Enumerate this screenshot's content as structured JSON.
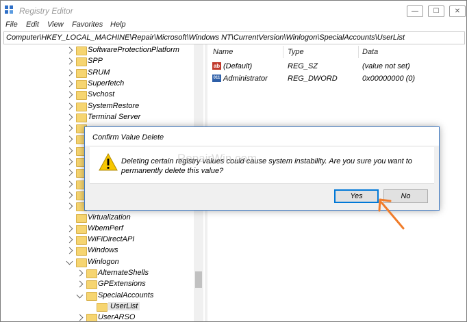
{
  "window": {
    "title": "Registry Editor"
  },
  "controls": {
    "minimize": "—",
    "maximize": "☐",
    "close": "✕"
  },
  "menu": [
    "File",
    "Edit",
    "View",
    "Favorites",
    "Help"
  ],
  "address": "Computer\\HKEY_LOCAL_MACHINE\\Repair\\Microsoft\\Windows NT\\CurrentVersion\\Winlogon\\SpecialAccounts\\UserList",
  "tree": [
    {
      "label": "SoftwareProtectionPlatform",
      "depth": 1,
      "state": "collapsed"
    },
    {
      "label": "SPP",
      "depth": 1,
      "state": "collapsed"
    },
    {
      "label": "SRUM",
      "depth": 1,
      "state": "collapsed"
    },
    {
      "label": "Superfetch",
      "depth": 1,
      "state": "collapsed"
    },
    {
      "label": "Svchost",
      "depth": 1,
      "state": "collapsed"
    },
    {
      "label": "SystemRestore",
      "depth": 1,
      "state": "collapsed"
    },
    {
      "label": "Terminal Server",
      "depth": 1,
      "state": "collapsed"
    },
    {
      "label": "",
      "depth": 1,
      "state": "collapsed"
    },
    {
      "label": "",
      "depth": 1,
      "state": "collapsed"
    },
    {
      "label": "",
      "depth": 1,
      "state": "collapsed"
    },
    {
      "label": "",
      "depth": 1,
      "state": "collapsed"
    },
    {
      "label": "",
      "depth": 1,
      "state": "collapsed"
    },
    {
      "label": "",
      "depth": 1,
      "state": "collapsed"
    },
    {
      "label": "",
      "depth": 1,
      "state": "collapsed"
    },
    {
      "label": "",
      "depth": 1,
      "state": "collapsed"
    },
    {
      "label": "Virtualization",
      "depth": 1,
      "state": "none"
    },
    {
      "label": "WbemPerf",
      "depth": 1,
      "state": "collapsed"
    },
    {
      "label": "WiFiDirectAPI",
      "depth": 1,
      "state": "collapsed"
    },
    {
      "label": "Windows",
      "depth": 1,
      "state": "collapsed"
    },
    {
      "label": "Winlogon",
      "depth": 1,
      "state": "expanded"
    },
    {
      "label": "AlternateShells",
      "depth": 2,
      "state": "collapsed"
    },
    {
      "label": "GPExtensions",
      "depth": 2,
      "state": "collapsed"
    },
    {
      "label": "SpecialAccounts",
      "depth": 2,
      "state": "expanded"
    },
    {
      "label": "UserList",
      "depth": 3,
      "state": "none",
      "selected": true
    },
    {
      "label": "UserARSO",
      "depth": 2,
      "state": "collapsed"
    }
  ],
  "list": {
    "headers": {
      "name": "Name",
      "type": "Type",
      "data": "Data"
    },
    "rows": [
      {
        "name": "(Default)",
        "type": "REG_SZ",
        "data": "(value not set)",
        "icon": "reg-sz-icon",
        "icon_text": "ab"
      },
      {
        "name": "Administrator",
        "type": "REG_DWORD",
        "data": "0x00000000 (0)",
        "icon": "reg-dword-icon",
        "icon_text": "011"
      }
    ]
  },
  "dialog": {
    "title": "Confirm Value Delete",
    "message": "Deleting certain registry values could cause system instability. Are you sure you want to permanently delete this value?",
    "yes": "Yes",
    "no": "No"
  },
  "watermark": "RepairWin.com",
  "colors": {
    "accent": "#0078d7",
    "arrow": "#f07c2a",
    "folder": "#f6d571"
  }
}
